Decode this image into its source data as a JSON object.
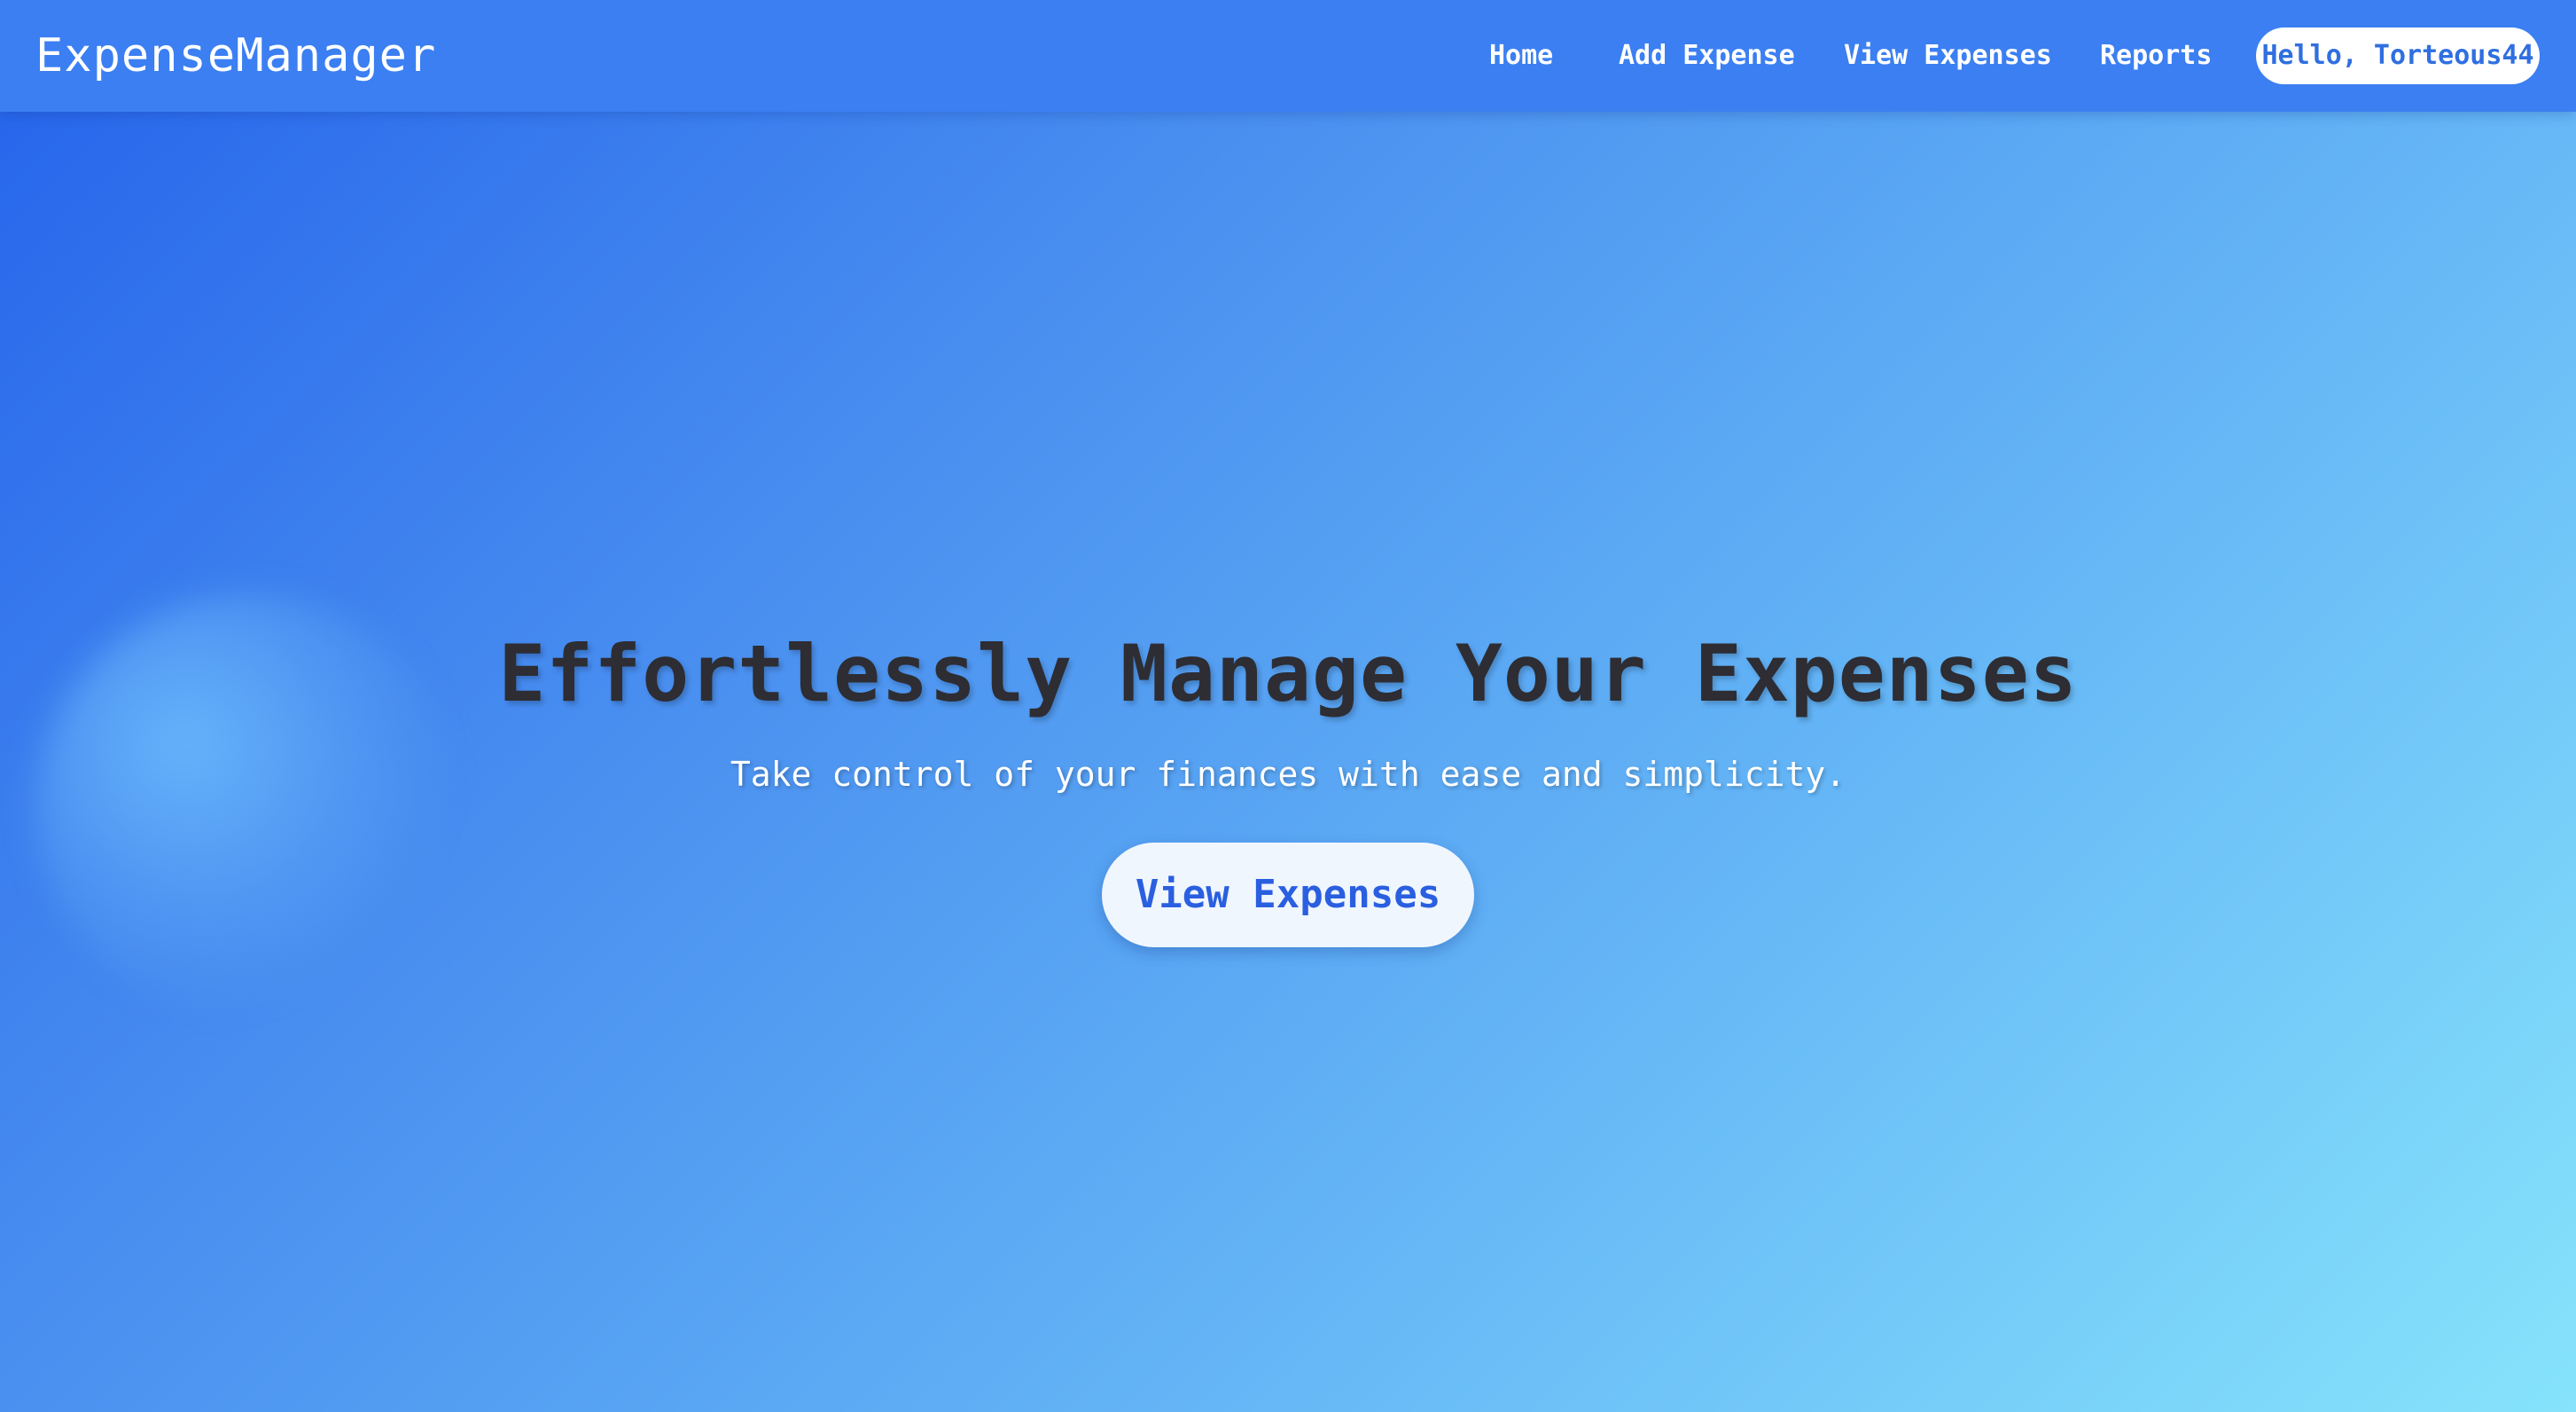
{
  "app": {
    "logo_text": "ExpenseManager"
  },
  "nav": {
    "items": [
      {
        "label": "Home"
      },
      {
        "label": "Add Expense"
      },
      {
        "label": "View Expenses"
      },
      {
        "label": "Reports"
      }
    ],
    "greeting": "Hello, Torteous44"
  },
  "hero": {
    "title": "Effortlessly Manage Your Expenses",
    "subtitle": "Take control of your finances with ease and simplicity.",
    "cta_label": "View Expenses"
  },
  "colors": {
    "navbar": "#3b7ff2",
    "gradient_start": "#2563eb",
    "gradient_end": "#86e3fb",
    "title_text": "#2d2d33",
    "cta_text": "#2a5fe0",
    "cta_background": "#f0f6fe"
  }
}
